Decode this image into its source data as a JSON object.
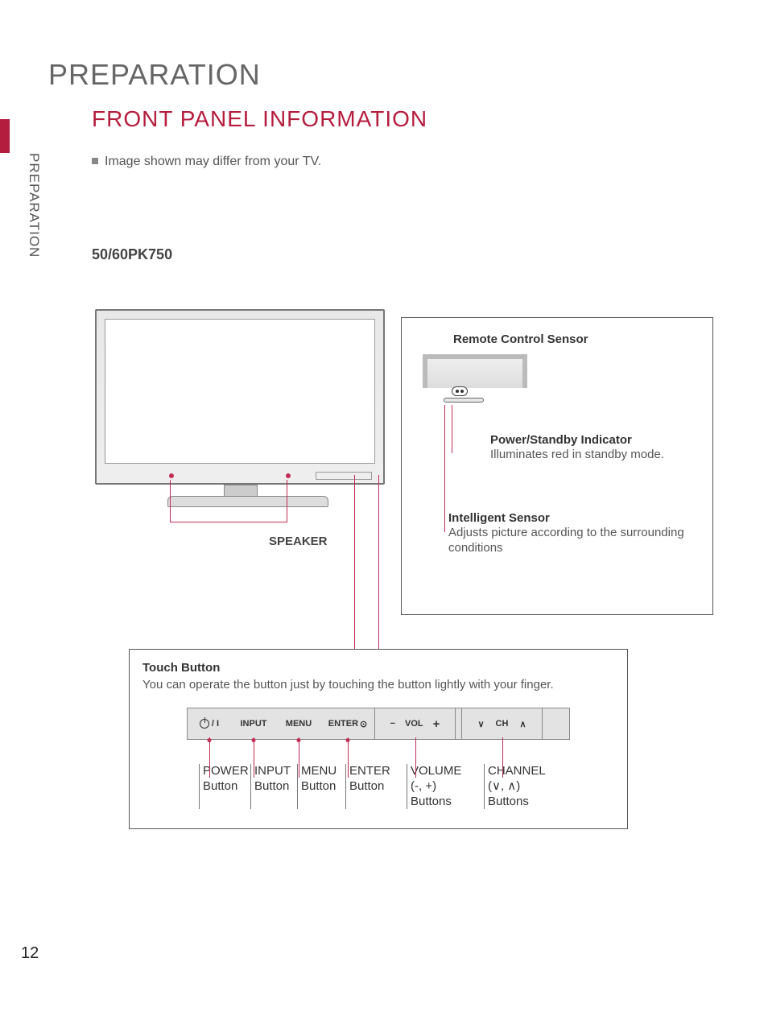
{
  "page_number": "12",
  "side_label": "PREPARATION",
  "page_title": "PREPARATION",
  "section_title": "FRONT PANEL INFORMATION",
  "note": "Image shown may differ from your TV.",
  "model": "50/60PK750",
  "speaker_label": "SPEAKER",
  "info": {
    "remote_sensor": "Remote Control Sensor",
    "power_title": "Power/Standby Indicator",
    "power_desc": "Illuminates red in standby mode.",
    "is_title": "Intelligent Sensor",
    "is_desc": "Adjusts picture according to the surrounding conditions"
  },
  "touch": {
    "title": "Touch Button",
    "desc": "You can operate the button just by touching the button lightly with your finger.",
    "panel": {
      "power_suffix": "/ I",
      "input": "INPUT",
      "menu": "MENU",
      "enter": "ENTER",
      "enter_ring": "⊙",
      "vol_minus": "−",
      "vol": "VOL",
      "vol_plus": "+",
      "ch_down": "∨",
      "ch": "CH",
      "ch_up": "∧"
    },
    "labels": {
      "power": "POWER\nButton",
      "input": "INPUT\nButton",
      "menu": "MENU\nButton",
      "enter": "ENTER\nButton",
      "volume": "VOLUME\n(-, +)\nButtons",
      "channel": "CHANNEL\n(∨, ∧)\nButtons"
    }
  }
}
